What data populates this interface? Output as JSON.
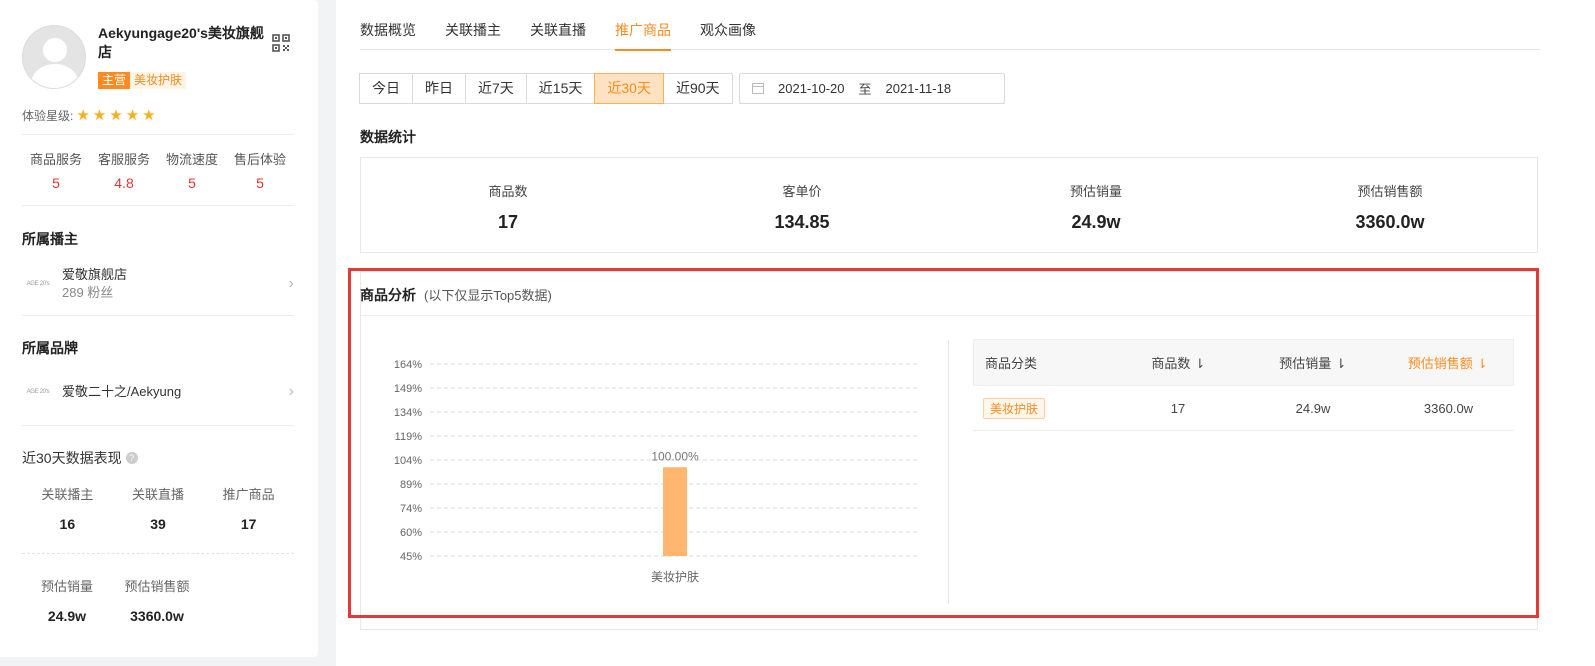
{
  "shop": {
    "name": "Aekyungage20's美妆旗舰店",
    "badge_main": "主营",
    "badge_category": "美妆护肤",
    "star_label": "体验星级:",
    "stars": 5
  },
  "scores": [
    {
      "label": "商品服务",
      "value": "5"
    },
    {
      "label": "客服服务",
      "value": "4.8"
    },
    {
      "label": "物流速度",
      "value": "5"
    },
    {
      "label": "售后体验",
      "value": "5"
    }
  ],
  "anchor_section": {
    "title": "所属播主",
    "name": "爱敬旗舰店",
    "sub": "289 粉丝",
    "logo_text": "AGE 20's"
  },
  "brand_section": {
    "title": "所属品牌",
    "name": "爱敬二十之/Aekyung",
    "logo_text": "AGE 20's"
  },
  "perf": {
    "title": "近30天数据表现",
    "help": "?",
    "row1": [
      {
        "label": "关联播主",
        "value": "16"
      },
      {
        "label": "关联直播",
        "value": "39"
      },
      {
        "label": "推广商品",
        "value": "17"
      }
    ],
    "row2": [
      {
        "label": "预估销量",
        "value": "24.9w"
      },
      {
        "label": "预估销售额",
        "value": "3360.0w"
      }
    ]
  },
  "tabs": [
    "数据概览",
    "关联播主",
    "关联直播",
    "推广商品",
    "观众画像"
  ],
  "active_tab": 3,
  "ranges": [
    "今日",
    "昨日",
    "近7天",
    "近15天",
    "近30天",
    "近90天"
  ],
  "active_range": 4,
  "date": {
    "start": "2021-10-20",
    "sep": "至",
    "end": "2021-11-18"
  },
  "stats": {
    "title": "数据统计",
    "items": [
      {
        "label": "商品数",
        "value": "17"
      },
      {
        "label": "客单价",
        "value": "134.85"
      },
      {
        "label": "预估销量",
        "value": "24.9w"
      },
      {
        "label": "预估销售额",
        "value": "3360.0w"
      }
    ]
  },
  "analysis": {
    "title": "商品分析",
    "note": "(以下仅显示Top5数据)"
  },
  "chart_data": {
    "type": "bar",
    "categories": [
      "美妆护肤"
    ],
    "values": [
      100
    ],
    "data_labels": [
      "100.00%"
    ],
    "yticks": [
      "164%",
      "149%",
      "134%",
      "119%",
      "104%",
      "89%",
      "74%",
      "60%",
      "45%"
    ],
    "ylim": [
      45,
      164
    ],
    "grid": true,
    "bar_color": "#ffb66e"
  },
  "table": {
    "headers": [
      "商品分类",
      "商品数",
      "预估销量",
      "预估销售额"
    ],
    "sort_icon": "⇂",
    "rows": [
      {
        "category": "美妆护肤",
        "count": "17",
        "sales": "24.9w",
        "revenue": "3360.0w"
      }
    ]
  },
  "colors": {
    "accent": "#ff8a1f",
    "score": "#e0362e",
    "highlight_border": "#e53935"
  }
}
